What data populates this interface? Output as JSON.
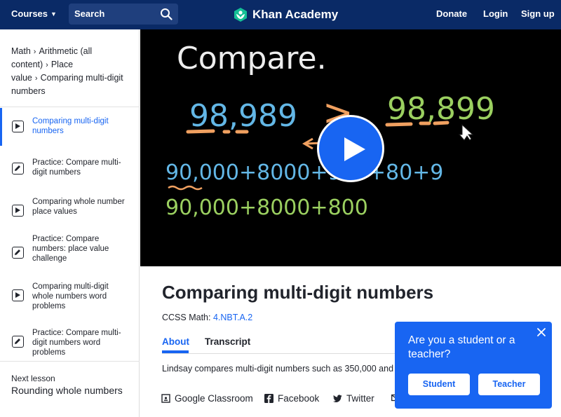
{
  "header": {
    "courses_label": "Courses",
    "search_label": "Search",
    "logo_text": "Khan Academy",
    "donate": "Donate",
    "login": "Login",
    "signup": "Sign up"
  },
  "breadcrumb": {
    "items": [
      "Math",
      "Arithmetic (all content)",
      "Place value",
      "Comparing multi-digit numbers"
    ]
  },
  "lessons": [
    {
      "type": "video",
      "icon": "play-icon",
      "label": "Comparing multi-digit numbers",
      "active": true
    },
    {
      "type": "practice",
      "icon": "pencil-icon",
      "label": "Practice: Compare multi-digit numbers",
      "active": false
    },
    {
      "type": "video",
      "icon": "play-icon",
      "label": "Comparing whole number place values",
      "active": false
    },
    {
      "type": "practice",
      "icon": "pencil-icon",
      "label": "Practice: Compare numbers: place value challenge",
      "active": false
    },
    {
      "type": "video",
      "icon": "play-icon",
      "label": "Comparing multi-digit whole numbers word problems",
      "active": false
    },
    {
      "type": "practice",
      "icon": "pencil-icon",
      "label": "Practice: Compare multi-digit numbers word problems",
      "active": false
    }
  ],
  "next_lesson": {
    "label": "Next lesson",
    "title": "Rounding whole numbers"
  },
  "video": {
    "board_title": "Compare.",
    "left_number": "98,989",
    "symbol": ">",
    "right_number": "98,899",
    "expanded_1": "90,000+8000+900+80+9",
    "expanded_2": "90,000+8000+800"
  },
  "main": {
    "title": "Comparing multi-digit numbers",
    "ccss_label": "CCSS Math:",
    "ccss_code": "4.NBT.A.2",
    "tabs": [
      "About",
      "Transcript"
    ],
    "description": "Lindsay compares multi-digit numbers such as 350,000 and 5",
    "share": [
      "Google Classroom",
      "Facebook",
      "Twitter"
    ]
  },
  "popup": {
    "question": "Are you a student or a teacher?",
    "student": "Student",
    "teacher": "Teacher"
  },
  "colors": {
    "header_bg": "#0a2a66",
    "accent": "#1865f2"
  }
}
